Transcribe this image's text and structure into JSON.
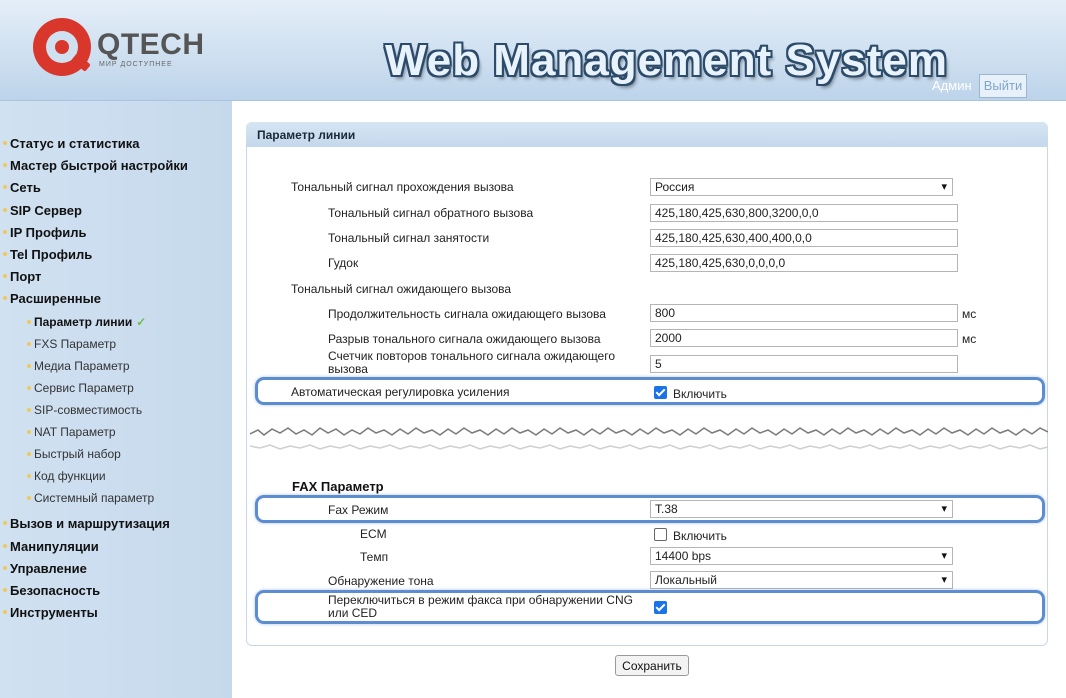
{
  "header": {
    "brand": "QTECH",
    "brand_tagline": "МИР ДОСТУПНЕЕ",
    "title": "Web Management System",
    "user": "Админ",
    "logout_label": "Выйти"
  },
  "sidebar": {
    "items": [
      {
        "label": "Статус и статистика"
      },
      {
        "label": "Мастер быстрой настройки"
      },
      {
        "label": "Сеть"
      },
      {
        "label": "SIP Сервер"
      },
      {
        "label": "IP Профиль"
      },
      {
        "label": "Tel Профиль"
      },
      {
        "label": "Порт"
      },
      {
        "label": "Расширенные"
      },
      {
        "label": "Вызов и маршрутизация"
      },
      {
        "label": "Манипуляции"
      },
      {
        "label": "Управление"
      },
      {
        "label": "Безопасность"
      },
      {
        "label": "Инструменты"
      }
    ],
    "sub_items": [
      {
        "label": "Параметр линии",
        "active": true
      },
      {
        "label": "FXS Параметр"
      },
      {
        "label": "Медиа Параметр"
      },
      {
        "label": "Сервис Параметр"
      },
      {
        "label": "SIP-совместимость"
      },
      {
        "label": "NAT Параметр"
      },
      {
        "label": "Быстрый набор"
      },
      {
        "label": "Код функции"
      },
      {
        "label": "Системный параметр"
      }
    ],
    "active_mark": "✓"
  },
  "panel": {
    "title": "Параметр линии",
    "ringback_country_label": "Тональный сигнал прохождения вызова",
    "ringback_country_value": "Россия",
    "ringback_tone_label": "Тональный сигнал обратного вызова",
    "ringback_tone_value": "425,180,425,630,800,3200,0,0",
    "busy_tone_label": "Тональный сигнал занятости",
    "busy_tone_value": "425,180,425,630,400,400,0,0",
    "dial_tone_label": "Гудок",
    "dial_tone_value": "425,180,425,630,0,0,0,0",
    "call_waiting_label": "Тональный сигнал ожидающего вызова",
    "cw_duration_label": "Продолжительность сигнала ожидающего вызова",
    "cw_duration_value": "800",
    "cw_duration_unit": "мс",
    "cw_gap_label": "Разрыв тонального сигнала ожидающего вызова",
    "cw_gap_value": "2000",
    "cw_gap_unit": "мс",
    "cw_repeat_label": "Счетчик повторов тонального сигнала ожидающего вызова",
    "cw_repeat_value": "5",
    "agc_label": "Автоматическая регулировка усиления",
    "agc_checked": true,
    "agc_option": "Включить",
    "fax_section": "FAX Параметр",
    "fax_mode_label": "Fax Режим",
    "fax_mode_value": "T.38",
    "ecm_label": "ECM",
    "ecm_checked": false,
    "ecm_option": "Включить",
    "rate_label": "Темп",
    "rate_value": "14400 bps",
    "tone_detect_label": "Обнаружение тона",
    "tone_detect_value": "Локальный",
    "cng_label": "Переключиться в режим факса при обнаружении CNG или CED",
    "cng_checked": true,
    "save_label": "Сохранить"
  },
  "colors": {
    "header_bg": "#c9dcee",
    "sidebar_bg": "#cadcee",
    "highlight": "#5b8dd0",
    "checkbox": "#1a73e8",
    "logo_red": "#d9372b"
  }
}
